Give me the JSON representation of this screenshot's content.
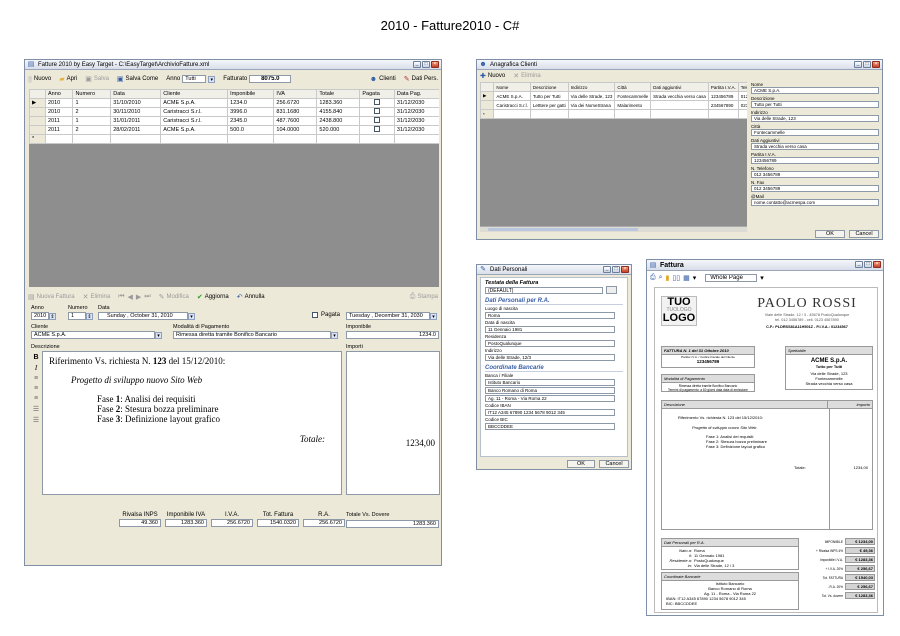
{
  "page_title": "2010 - Fatture2010 - C#",
  "main": {
    "title": "Fatture 2010 by Easy Target - C:\\EasyTarget\\ArchivioFatture.xml",
    "toolbar": {
      "nuovo": "Nuovo",
      "apri": "Apri",
      "salva": "Salva",
      "salva_come": "Salva Come",
      "anno_label": "Anno",
      "anno_value": "Tutti",
      "fatturato_label": "Fatturato",
      "fatturato_value": "8075.0",
      "clienti": "Clienti",
      "dati_pers": "Dati Pers."
    },
    "grid": {
      "headers": [
        "Anno",
        "Numero",
        "Data",
        "Cliente",
        "Imponibile",
        "IVA",
        "Totale",
        "Pagata",
        "Data Pag."
      ],
      "rows": [
        [
          "2010",
          "1",
          "31/10/2010",
          "ACME S.p.A.",
          "1234.0",
          "256.6720",
          "1283.360",
          "",
          "31/12/2030"
        ],
        [
          "2010",
          "2",
          "30/11/2010",
          "Caristracci S.r.l.",
          "3996.0",
          "831.1680",
          "4155.840",
          "",
          "31/12/2030"
        ],
        [
          "2011",
          "1",
          "31/01/2011",
          "Caristracci S.r.l.",
          "2345.0",
          "487.7600",
          "2438.800",
          "",
          "31/12/2030"
        ],
        [
          "2011",
          "2",
          "28/02/2011",
          "ACME S.p.A.",
          "500.0",
          "104.0000",
          "520.000",
          "",
          "31/12/2030"
        ]
      ],
      "new_row_marker": "*"
    },
    "nav": {
      "nuova": "Nuova Fattura",
      "elimina": "Elimina",
      "modifica": "Modifica",
      "aggiorna": "Aggiorna",
      "annulla": "Annulla",
      "stampa": "Stampa"
    },
    "form": {
      "anno_label": "Anno",
      "anno_value": "2010",
      "numero_label": "Numero",
      "numero_value": "1",
      "data_label": "Data",
      "data_value": "Sunday  ,  October  31, 2010",
      "pagata": "Pagata",
      "data_pag": "Tuesday  , December 31, 2030",
      "cliente_label": "Cliente",
      "cliente_value": "ACME S.p.A.",
      "modalita_label": "Modalità di Pagamento",
      "modalita_value": "Rimessa diretta tramite Bonifico Bancario",
      "imponibile_label": "Imponibile",
      "imponibile_value": "1234.0",
      "descrizione_label": "Descrizione",
      "importi_label": "Importi",
      "desc_line1": "Riferimento Vs. richiesta N. ",
      "desc_num": "123",
      "desc_line1b": " del 15/12/2010:",
      "desc_line2": "Progetto di sviluppo nuovo Sito Web",
      "fasi": [
        {
          "k": "Fase ",
          "n": "1",
          "t": ": Analisi dei requisiti"
        },
        {
          "k": "Fase ",
          "n": "2",
          "t": ": Stesura bozza preliminare"
        },
        {
          "k": "Fase ",
          "n": "3",
          "t": ": Definizione layout grafico"
        }
      ],
      "totale_label": "Totale:",
      "totale_value": "1234,00"
    },
    "summary": [
      {
        "label": "Rivalsa INPS",
        "value": "49.360"
      },
      {
        "label": "Imponibile IVA",
        "value": "1283.360"
      },
      {
        "label": "I.V.A.",
        "value": "256.6720"
      },
      {
        "label": "Tot. Fattura",
        "value": "1540.0320"
      },
      {
        "label": "R.A.",
        "value": "256.6720"
      }
    ],
    "totale_dovere_label": "Totale Vs. Dovere",
    "totale_dovere_value": "1283.360"
  },
  "clienti": {
    "title": "Anagrafica Clienti",
    "nuovo": "Nuovo",
    "elimina": "Elimina",
    "headers": [
      "Nome",
      "Descrizione",
      "Indirizzo",
      "Città",
      "Dati aggiuntivi",
      "Partita I.V.A.",
      "Tele"
    ],
    "rows": [
      [
        "ACME S.p.A.",
        "Tutto per Tutti",
        "Via delle Strade, 123",
        "Fontecammelle",
        "Strada vecchia verso casa",
        "123456789",
        "012"
      ],
      [
        "Caristracci S.r.l.",
        "Letttere per gatti",
        "Via dei NomeStrana",
        "Malarimento",
        "",
        "234567890",
        "023"
      ]
    ],
    "new_row_marker": "*",
    "fields": [
      {
        "label": "Nome",
        "value": "ACME S.p.A."
      },
      {
        "label": "Descrizione",
        "value": "Tutto per Tutti"
      },
      {
        "label": "Indirizzo",
        "value": "Via delle Strade, 123"
      },
      {
        "label": "Città",
        "value": "Fontecammelle"
      },
      {
        "label": "Dati Aggiuntivi",
        "value": "Strada vecchia verso casa"
      },
      {
        "label": "Partita I.V.A.",
        "value": "123456789"
      },
      {
        "label": "N. Telefono",
        "value": "012 3456789"
      },
      {
        "label": "N. Fax",
        "value": "012 3456789"
      },
      {
        "label": "@Mail",
        "value": "nome.contatto@acmespa.com"
      }
    ],
    "ok": "OK",
    "cancel": "Cancel"
  },
  "personali": {
    "title": "Dati Personali",
    "testata_label": "Testata della Fattura",
    "testata_value": "(DEFAULT)",
    "sec1": "Dati Personali per R.A.",
    "fields1": [
      {
        "label": "Luogo di nascita",
        "value": "Roma"
      },
      {
        "label": "Data di nascita",
        "value": "11 Gennaio 1981"
      },
      {
        "label": "Residenza",
        "value": "PostoQualunque"
      },
      {
        "label": "Indirizzo",
        "value": "Via delle Strade, 12/3"
      }
    ],
    "sec2": "Coordinate Bancarie",
    "fields2": [
      {
        "label": "Banca / Filiale",
        "value": "Istituto Bancario"
      },
      {
        "label": "",
        "value": "Banco Romano di Roma"
      },
      {
        "label": "",
        "value": "Ag. 11 - Roma - Via Roma 22"
      },
      {
        "label": "Codice IBAN",
        "value": "IT12 A345 67890 1234 5678 9012 345"
      },
      {
        "label": "Codice BIC",
        "value": "BBCCDDEE"
      }
    ],
    "ok": "OK",
    "cancel": "Cancel"
  },
  "fattura": {
    "title": "Fattura",
    "page_mode": "Whole Page",
    "logo": [
      "TUO",
      "TUOLOGO",
      "LOGO"
    ],
    "name": "PAOLO ROSSI",
    "addr1": "Viale delle Strade, 12 / 3 - 45678 PostoQualunque",
    "addr2": "tel. 012 3456789 - cell. 0123 4567890",
    "cf": "C.F.: PLDRSS81A11H501Z  -  P.I.V.A.: 01234567",
    "fattura_n": "FATTURA N.   1    del  31 Ottobre 2010",
    "piva_note": "Partita I.V.A. / Codice Fiscale del Cliente",
    "piva_val": "123456789",
    "spett_label": "Spettabile",
    "client_name": "ACME S.p.A.",
    "client_desc": "Tutto per Tutti",
    "client_addr": [
      "Via delle Strade, 123",
      "Fontecammelle",
      "Strada vecchia verso casa"
    ],
    "modalita_label": "Modalità di Pagamento",
    "modalita_text": "Rimessa diretta tramite Bonifico Bancario",
    "modalita_text2": "Termini di pagamento: a 60 giorni data data di emissione",
    "desc_label": "Descrizione",
    "importo_label": "Importo",
    "desc_ref": "Riferimento Vs. richiesta N. 123 del 15/12/2010:",
    "desc_proj": "Progetto di sviluppo nuovo Sito Web",
    "fasi": [
      "Fase 1: Analisi dei requisiti",
      "Fase 2: Stesura bozza preliminare",
      "Fase 3: Definizione layout grafico"
    ],
    "totale_label": "Totale:",
    "totale_value": "1234,00",
    "dati_pers": "Dati Personali per R.A.",
    "nato": [
      {
        "k": "Nato a:",
        "v": "Roma"
      },
      {
        "k": "il:",
        "v": "11 Gennaio 1981"
      },
      {
        "k": "Residente a:",
        "v": "PostoQualunque"
      },
      {
        "k": "in:",
        "v": "Via delle Strade, 12 / 3"
      }
    ],
    "coord": "Coordinate Bancarie",
    "banca": [
      "Istituto Bancario",
      "Banco Romano di Roma",
      "Ag. 11 - Roma - Via Roma 22"
    ],
    "iban": "IBAN:  IT12 A345 67890 1234 5678 9012 345",
    "bic": "BIC:   BBCCDDEE",
    "totali": [
      {
        "k": "IMPONIBILE",
        "v": "€ 1234,00"
      },
      {
        "k": "+ Rivalsa INPS 4%",
        "v": "€ 49,36"
      },
      {
        "k": "Imponibile I.V.A.",
        "v": "€ 1283,36"
      },
      {
        "k": "+ I.V.A. 20%",
        "v": "€ 256,67"
      },
      {
        "k": "Tot. FATTURA",
        "v": "€ 1540,03"
      },
      {
        "k": "- R.A. 20%",
        "v": "€ 256,67"
      },
      {
        "k": "Tot. Vs. dovere",
        "v": "€ 1283,36"
      }
    ]
  },
  "colors": {
    "accent": "#2c59a8",
    "grey_area": "#8e8e8e",
    "section_blue": "#3a5fa8"
  }
}
